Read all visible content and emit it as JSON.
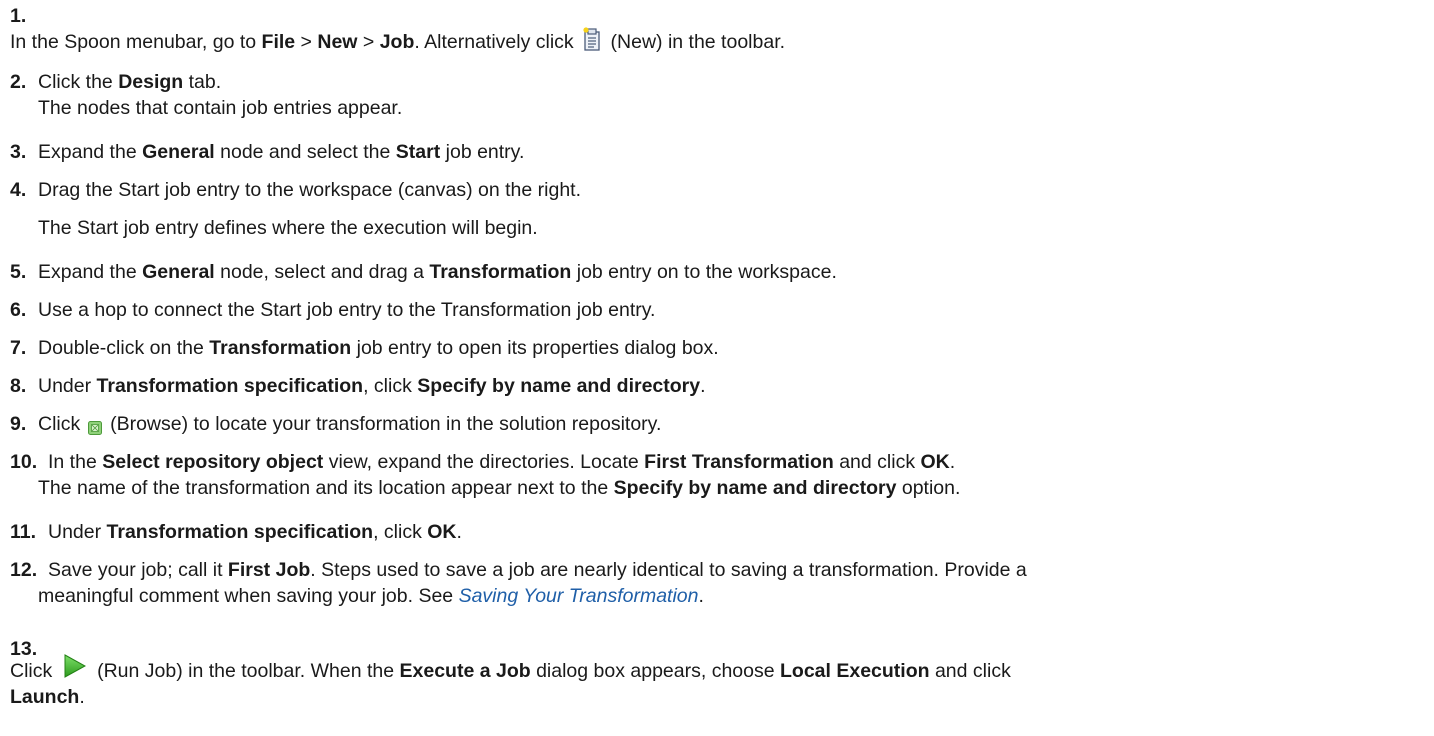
{
  "steps": [
    {
      "num": "1.",
      "parts": [
        "In the Spoon menubar, go to ",
        "File",
        " > ",
        "New",
        " > ",
        "Job",
        ". Alternatively click ",
        " (New) in the toolbar."
      ]
    },
    {
      "num": "2.",
      "parts": [
        "Click the ",
        "Design",
        " tab."
      ],
      "line2": "The nodes that contain job entries appear."
    },
    {
      "num": "3.",
      "parts": [
        "Expand the ",
        "General",
        " node and select the ",
        "Start",
        " job entry."
      ]
    },
    {
      "num": "4.",
      "text": "Drag the Start job entry to the workspace (canvas) on the right.",
      "note": "The Start job entry defines where the execution will begin."
    },
    {
      "num": "5.",
      "parts": [
        "Expand the ",
        "General",
        " node, select and drag a ",
        "Transformation",
        " job entry on to the workspace."
      ]
    },
    {
      "num": "6.",
      "text": "Use a hop to connect the Start job entry to the Transformation job entry."
    },
    {
      "num": "7.",
      "parts": [
        "Double-click on the ",
        "Transformation",
        " job entry to open its properties dialog box."
      ]
    },
    {
      "num": "8.",
      "parts": [
        "Under ",
        "Transformation specification",
        ", click ",
        "Specify by name and directory",
        "."
      ]
    },
    {
      "num": "9.",
      "parts": [
        "Click ",
        " (Browse) to locate your transformation in the solution repository."
      ]
    },
    {
      "num": "10.",
      "parts": [
        "In the ",
        "Select repository object",
        " view, expand the directories. Locate ",
        "First Transformation",
        " and click ",
        "OK",
        "."
      ],
      "line2parts": [
        "The name of the transformation and its location appear next to the ",
        "Specify by name and directory",
        " option."
      ]
    },
    {
      "num": "11.",
      "parts": [
        "Under ",
        "Transformation specification",
        ", click ",
        "OK",
        "."
      ]
    },
    {
      "num": "12.",
      "parts": [
        "Save your job; call it ",
        "First Job",
        ". Steps used to save a job are nearly identical to saving a transformation. Provide a"
      ],
      "line2parts": [
        "meaningful comment when saving your job. See ",
        "Saving Your Transformation",
        "."
      ]
    },
    {
      "num": "13.",
      "parts": [
        "Click ",
        " (Run Job) in the toolbar. When the ",
        "Execute a Job",
        " dialog box appears, choose ",
        "Local Execution",
        " and click"
      ],
      "line2parts": [
        "Launch",
        "."
      ]
    }
  ],
  "icons": {
    "new": "new-document-icon",
    "browse": "browse-icon",
    "run": "run-job-icon"
  },
  "colors": {
    "link": "#1f5fa8",
    "run_green": "#3cb026"
  }
}
